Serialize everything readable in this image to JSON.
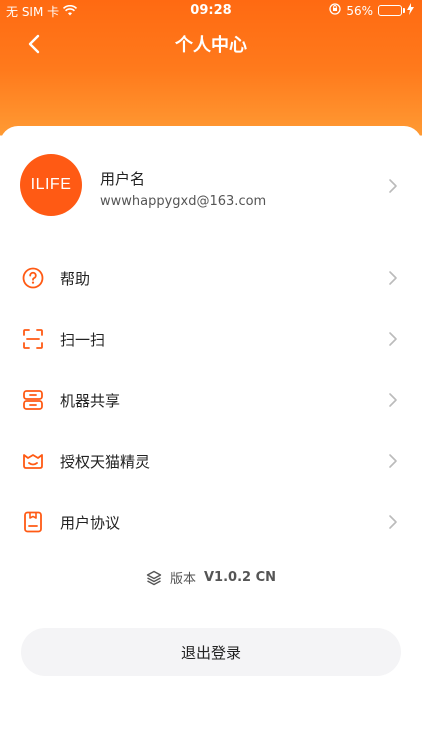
{
  "status_bar": {
    "carrier": "无 SIM 卡",
    "time": "09:28",
    "battery_percent": "56%",
    "battery_level": 0.56
  },
  "navbar": {
    "title": "个人中心",
    "back_icon": "chevron-left-icon"
  },
  "profile": {
    "avatar_text": "ILIFE",
    "username": "用户名",
    "email": "wwwhappygxd@163.com"
  },
  "menu": [
    {
      "label": "帮助",
      "icon": "help-icon"
    },
    {
      "label": "扫一扫",
      "icon": "scan-icon"
    },
    {
      "label": "机器共享",
      "icon": "share-device-icon"
    },
    {
      "label": "授权天猫精灵",
      "icon": "tmall-genie-icon"
    },
    {
      "label": "用户协议",
      "icon": "agreement-icon"
    }
  ],
  "version": {
    "label": "版本",
    "value": "V1.0.2 CN"
  },
  "logout_label": "退出登录",
  "colors": {
    "accent": "#ff5a14",
    "header_gradient_top": "#ff6a12",
    "header_gradient_bottom": "#ff9a33"
  }
}
